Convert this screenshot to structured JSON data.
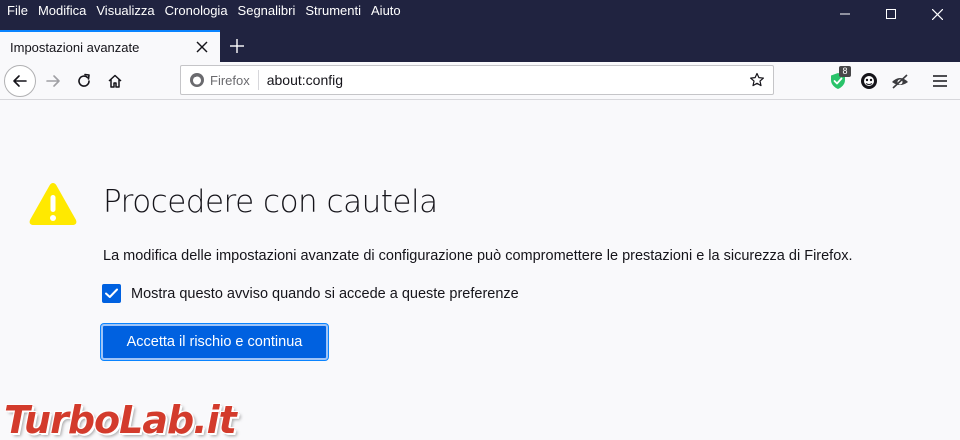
{
  "menu": {
    "items": [
      "File",
      "Modifica",
      "Visualizza",
      "Cronologia",
      "Segnalibri",
      "Strumenti",
      "Aiuto"
    ]
  },
  "tab": {
    "title": "Impostazioni avanzate"
  },
  "urlbar": {
    "identity_label": "Firefox",
    "url": "about:config"
  },
  "extensions": {
    "badge_count": "8"
  },
  "page": {
    "title": "Procedere con cautela",
    "description": "La modifica delle impostazioni avanzate di configurazione può compromettere le prestazioni e la sicurezza di Firefox.",
    "checkbox_label": "Mostra questo avviso quando si accede a queste preferenze",
    "checkbox_checked": true,
    "accept_button": "Accetta il rischio e continua"
  },
  "watermark": "TurboLab.it",
  "colors": {
    "titlebar": "#202340",
    "accent": "#0061e0",
    "warning": "#ffe900"
  }
}
